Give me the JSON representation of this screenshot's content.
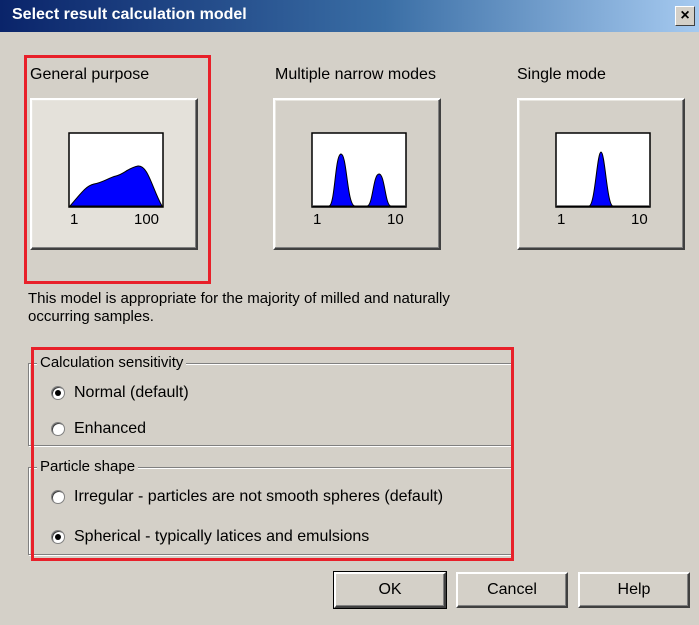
{
  "window": {
    "title": "Select result calculation model",
    "close_glyph": "×"
  },
  "models": [
    {
      "label": "General purpose",
      "axis_min": "1",
      "axis_max": "100",
      "selected": true
    },
    {
      "label": "Multiple narrow modes",
      "axis_min": "1",
      "axis_max": "10",
      "selected": false
    },
    {
      "label": "Single mode",
      "axis_min": "1",
      "axis_max": "10",
      "selected": false
    }
  ],
  "description": "This  model is appropriate for the majority of milled and naturally occurring samples.",
  "sensitivity": {
    "title": "Calculation sensitivity",
    "options": [
      {
        "label": "Normal (default)",
        "checked": true
      },
      {
        "label": "Enhanced",
        "checked": false
      }
    ]
  },
  "particle_shape": {
    "title": "Particle shape",
    "options": [
      {
        "label": "Irregular - particles are not smooth spheres (default)",
        "checked": false
      },
      {
        "label": "Spherical - typically latices and emulsions",
        "checked": true
      }
    ]
  },
  "buttons": {
    "ok": "OK",
    "cancel": "Cancel",
    "help": "Help"
  },
  "colors": {
    "distribution_fill": "#0000ff",
    "highlight": "#e8202a",
    "dialog_bg": "#d4d0c8"
  }
}
